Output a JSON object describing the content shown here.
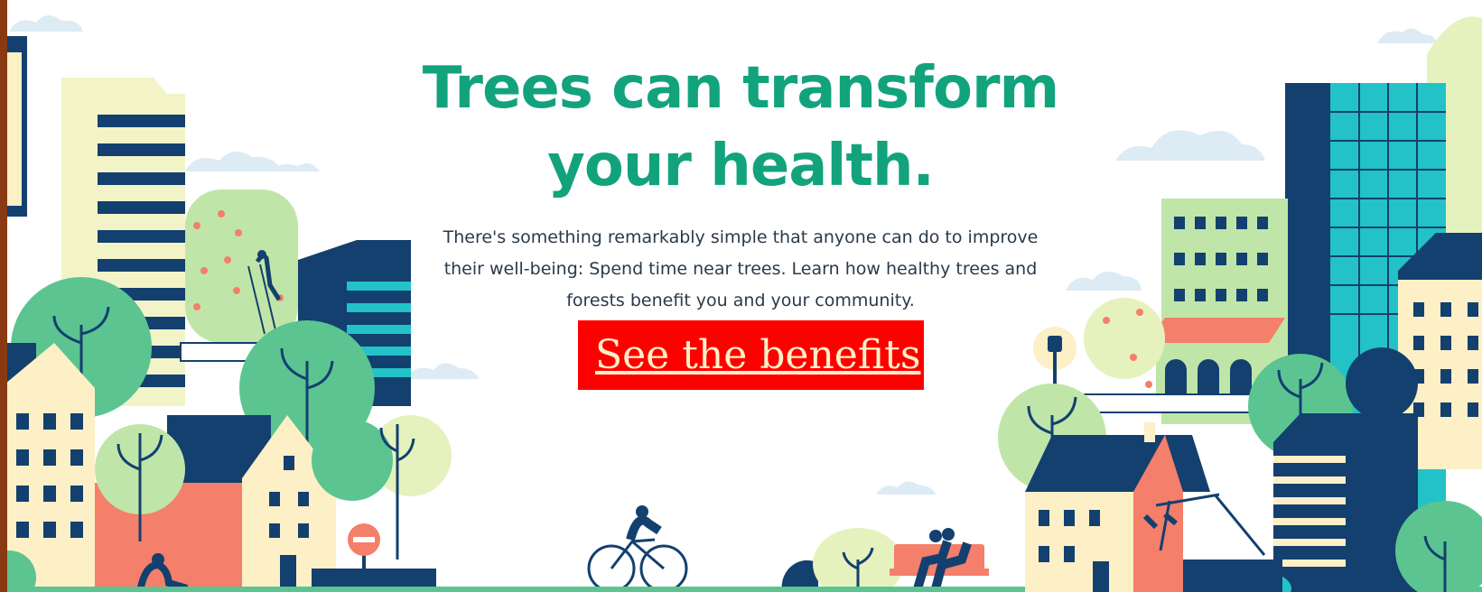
{
  "hero": {
    "headline_line1": "Trees can transform",
    "headline_line2": "your health.",
    "subtext": "There's something remarkably simple that anyone can do to improve their well-being: Spend time near trees. Learn how healthy trees and forests benefit you and your community."
  },
  "cta": {
    "label": "See the benefits"
  },
  "colors": {
    "headline": "#12a37d",
    "cta_background": "#ff0000",
    "cta_text": "#fdf0c8",
    "navy": "#13406f",
    "teal": "#22c2c7",
    "coral": "#f47f6b",
    "cream": "#fdefc6",
    "light_green": "#bfe6a8",
    "mid_green": "#5cc491"
  }
}
